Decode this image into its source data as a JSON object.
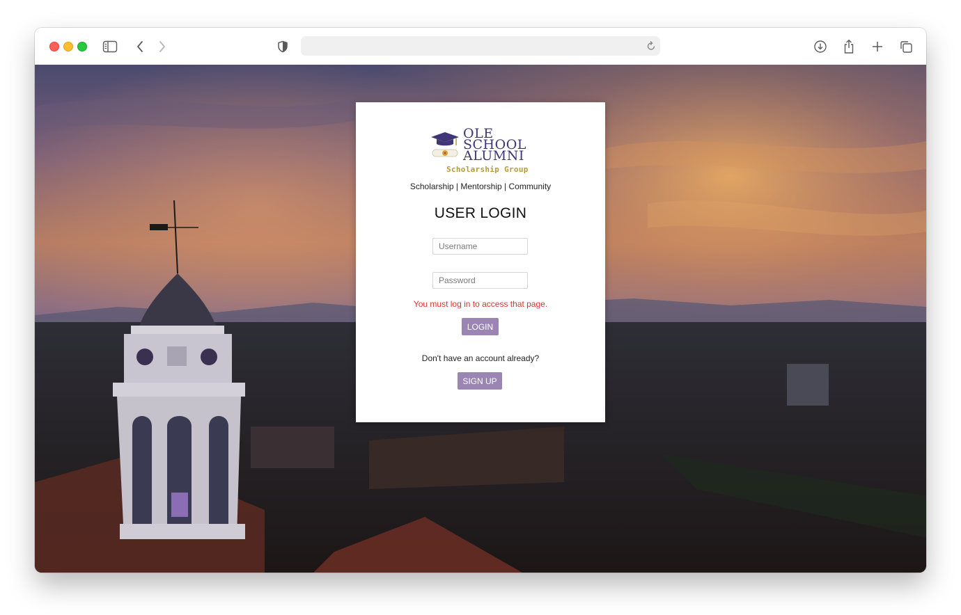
{
  "browser": {
    "address_text": "",
    "icons": [
      "sidebar-icon",
      "back-icon",
      "forward-icon",
      "shield-icon",
      "reload-icon",
      "download-icon",
      "share-icon",
      "new-tab-icon",
      "tabs-overview-icon"
    ]
  },
  "logo": {
    "line1": "OLE",
    "line2": "SCHOOL",
    "line3": "ALUMNI",
    "subtitle": "Scholarship Group"
  },
  "colors": {
    "logo_purple": "#3f3577",
    "logo_gold": "#b59a37",
    "button_purple": "#9a85b3",
    "error_red": "#d9332e"
  },
  "tagline": "Scholarship | Mentorship | Community",
  "login": {
    "heading": "USER LOGIN",
    "username_placeholder": "Username",
    "password_placeholder": "Password",
    "error_message": "You must log in to access that page.",
    "login_button": "LOGIN",
    "no_account_text": "Don't have an account already?",
    "signup_button": "SIGN UP"
  }
}
